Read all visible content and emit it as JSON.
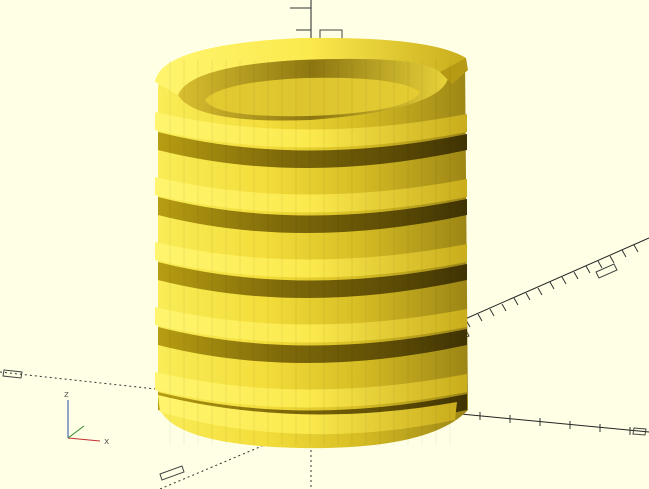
{
  "viewport": {
    "background": "#ffffe5",
    "model": "threaded-cylinder",
    "model_color": "#f6e64a",
    "axis_color": "#000000",
    "dotted_axis_color": "#333333"
  },
  "axes_indicator": {
    "x_label": "x",
    "z_label": "z",
    "icon": "axes-orientation-icon"
  }
}
